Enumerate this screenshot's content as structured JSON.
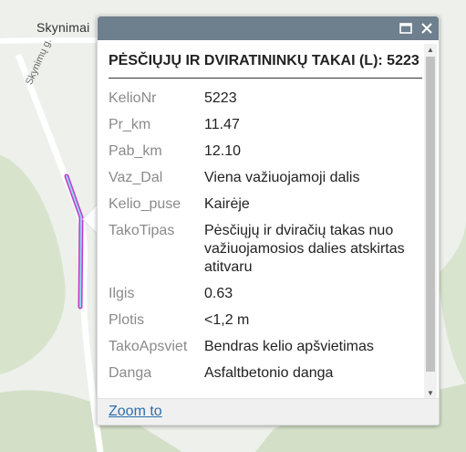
{
  "map": {
    "place_label": "Skynimai",
    "road_label": "Skynimų g.",
    "colors": {
      "background": "#eef0ec",
      "green_area": "#d3dfc7",
      "road": "#ffffff",
      "highlight": "#c13cc7",
      "highlight_inner": "#8fd3ef"
    }
  },
  "popup": {
    "header_color": "#6e7f8e",
    "maximize_icon": "maximize-icon",
    "close_icon": "close-icon",
    "title": "PĖSČIŲJŲ IR DVIRATININKŲ TAKAI (L): 5223",
    "attributes": [
      {
        "name": "KelioNr",
        "value": "5223"
      },
      {
        "name": "Pr_km",
        "value": "11.47"
      },
      {
        "name": "Pab_km",
        "value": "12.10"
      },
      {
        "name": "Vaz_Dal",
        "value": "Viena važiuojamoji dalis"
      },
      {
        "name": "Kelio_puse",
        "value": "Kairėje"
      },
      {
        "name": "TakoTipas",
        "value": "Pėsčiųjų ir dviračių takas nuo važiuojamosios dalies atskirtas atitvaru"
      },
      {
        "name": "Ilgis",
        "value": "0.63"
      },
      {
        "name": "Plotis",
        "value": "<1,2 m"
      },
      {
        "name": "TakoApsviet",
        "value": "Bendras kelio apšvietimas"
      },
      {
        "name": "Danga",
        "value": "Asfaltbetonio danga"
      }
    ],
    "zoom_link": "Zoom to"
  }
}
